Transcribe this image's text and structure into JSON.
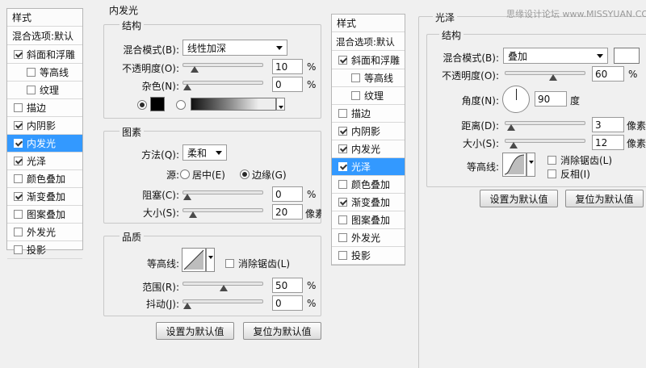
{
  "watermark": "思缘设计论坛 www.MISSYUAN.COM",
  "panel1": {
    "style_list": {
      "header": "样式",
      "blend_options": "混合选项:默认",
      "items": [
        {
          "label": "斜面和浮雕",
          "checked": true
        },
        {
          "label": "等高线",
          "checked": false
        },
        {
          "label": "纹理",
          "checked": false
        },
        {
          "label": "描边",
          "checked": false
        },
        {
          "label": "内阴影",
          "checked": true
        },
        {
          "label": "内发光",
          "checked": true,
          "selected": true
        },
        {
          "label": "光泽",
          "checked": true
        },
        {
          "label": "颜色叠加",
          "checked": false
        },
        {
          "label": "渐变叠加",
          "checked": true
        },
        {
          "label": "图案叠加",
          "checked": false
        },
        {
          "label": "外发光",
          "checked": false
        },
        {
          "label": "投影",
          "checked": false
        }
      ]
    },
    "section_title": "内发光",
    "structure": {
      "title": "结构",
      "blend_mode_label": "混合模式(B):",
      "blend_mode_value": "线性加深",
      "opacity_label": "不透明度(O):",
      "opacity_value": "10",
      "opacity_unit": "%",
      "opacity_fraction": 0.1,
      "noise_label": "杂色(N):",
      "noise_value": "0",
      "noise_unit": "%",
      "noise_fraction": 0.0,
      "color_swatch": "#000000"
    },
    "elements": {
      "title": "图素",
      "method_label": "方法(Q):",
      "method_value": "柔和",
      "source_label": "源:",
      "source_center": "居中(E)",
      "source_edge": "边缘(G)",
      "choke_label": "阻塞(C):",
      "choke_value": "0",
      "choke_unit": "%",
      "choke_fraction": 0.0,
      "size_label": "大小(S):",
      "size_value": "20",
      "size_unit": "像素",
      "size_fraction": 0.08
    },
    "quality": {
      "title": "品质",
      "contour_label": "等高线:",
      "antialias_label": "消除锯齿(L)",
      "range_label": "范围(R):",
      "range_value": "50",
      "range_unit": "%",
      "range_fraction": 0.5,
      "jitter_label": "抖动(J):",
      "jitter_value": "0",
      "jitter_unit": "%",
      "jitter_fraction": 0.0
    },
    "buttons": {
      "set_default": "设置为默认值",
      "reset_default": "复位为默认值"
    }
  },
  "panel2": {
    "style_list": {
      "header": "样式",
      "blend_options": "混合选项:默认",
      "items": [
        {
          "label": "斜面和浮雕",
          "checked": true
        },
        {
          "label": "等高线",
          "checked": false
        },
        {
          "label": "纹理",
          "checked": false
        },
        {
          "label": "描边",
          "checked": false
        },
        {
          "label": "内阴影",
          "checked": true
        },
        {
          "label": "内发光",
          "checked": true
        },
        {
          "label": "光泽",
          "checked": true,
          "selected": true
        },
        {
          "label": "颜色叠加",
          "checked": false
        },
        {
          "label": "渐变叠加",
          "checked": true
        },
        {
          "label": "图案叠加",
          "checked": false
        },
        {
          "label": "外发光",
          "checked": false
        },
        {
          "label": "投影",
          "checked": false
        }
      ]
    },
    "section_title": "光泽",
    "structure": {
      "title": "结构",
      "blend_mode_label": "混合模式(B):",
      "blend_mode_value": "叠加",
      "color_swatch": "#ffffff",
      "opacity_label": "不透明度(O):",
      "opacity_value": "60",
      "opacity_unit": "%",
      "opacity_fraction": 0.6,
      "angle_label": "角度(N):",
      "angle_value": "90",
      "angle_unit": "度",
      "distance_label": "距离(D):",
      "distance_value": "3",
      "distance_unit": "像素",
      "distance_fraction": 0.02,
      "size_label": "大小(S):",
      "size_value": "12",
      "size_unit": "像素",
      "size_fraction": 0.05,
      "contour_label": "等高线:",
      "antialias_label": "消除锯齿(L)",
      "invert_label": "反相(I)"
    },
    "buttons": {
      "set_default": "设置为默认值",
      "reset_default": "复位为默认值"
    }
  }
}
